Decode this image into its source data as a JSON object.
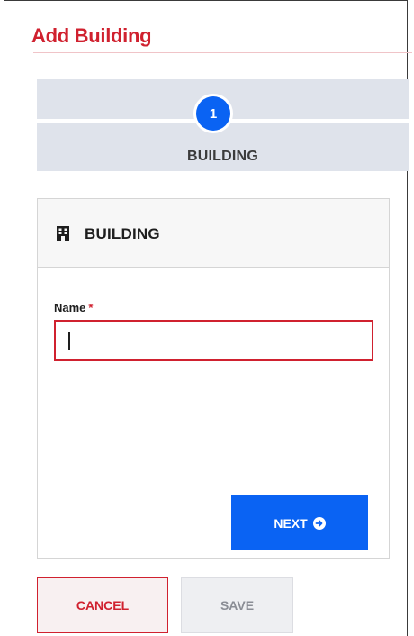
{
  "page": {
    "title": "Add Building"
  },
  "stepper": {
    "steps": [
      {
        "number": "1",
        "label": "BUILDING",
        "state": "active"
      }
    ]
  },
  "card": {
    "header_label": "BUILDING",
    "header_icon": "building-icon"
  },
  "form": {
    "name_label": "Name",
    "name_required_marker": "*",
    "name_value": "",
    "name_placeholder": ""
  },
  "actions": {
    "next_label": "NEXT",
    "next_icon": "arrow-circle-right-icon",
    "cancel_label": "CANCEL",
    "save_label": "SAVE"
  },
  "colors": {
    "accent_red": "#d0212f",
    "primary_blue": "#0a63f3",
    "stepper_bg": "#dfe3eb"
  }
}
